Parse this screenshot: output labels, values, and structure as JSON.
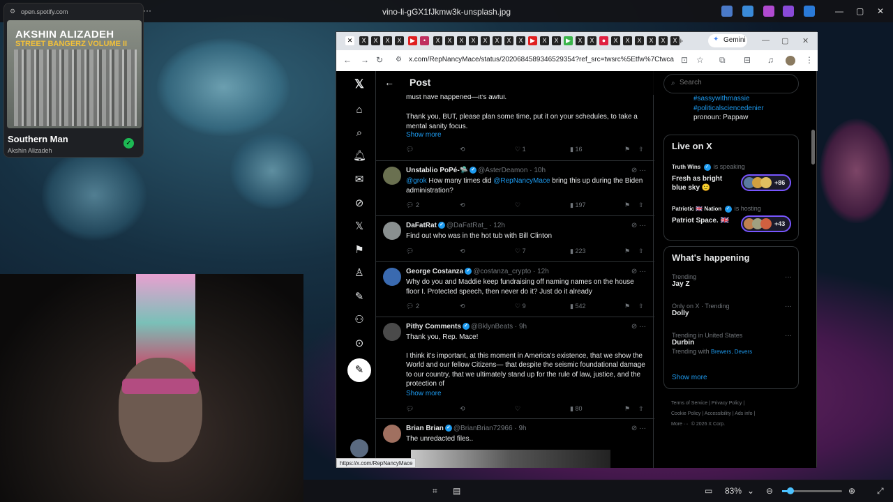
{
  "os": {
    "window_title": "vino-li-gGX1fJkmw3k-unsplash.jpg",
    "zoom": "83%"
  },
  "spotify": {
    "url": "open.spotify.com",
    "album_line1": "AKSHIN ALIZADEH",
    "album_line2": "STREET BANGERZ VOLUME II",
    "song": "Southern Man",
    "artist": "Akshin Alizadeh"
  },
  "browser": {
    "gemini_label": "Gemini",
    "url": "x.com/RepNancyMace/status/2020684589346529354?ref_src=twsrc%5Etfw%7Ctwcamp%5...",
    "status_url": "https://x.com/RepNancyMace"
  },
  "feed": {
    "header_title": "Post",
    "top_fragment_1": "must have happened—it's awful.",
    "top_fragment_2": "Thank you, BUT, please plan some time, put it on your schedules, to take a mental sanity focus.",
    "top_show_more": "Show more",
    "top_actions": {
      "likes": "1",
      "views": "16"
    },
    "tweets": [
      {
        "name": "Unstablio PoPé-🛸",
        "handle": "@AsterDeamon · 10h",
        "mention1": "@grok",
        "text_mid": " How many times did ",
        "mention2": "@RepNancyMace",
        "text_end": " bring this up during the Biden administration?",
        "replies": "2",
        "likes": "",
        "views": "197"
      },
      {
        "name": "DaFatRat",
        "handle": "@DaFatRat_ · 12h",
        "text": "Find out who was in the hot tub with Bill Clinton",
        "replies": "",
        "likes": "7",
        "views": "223"
      },
      {
        "name": "George Costanza",
        "handle": "@costanza_crypto · 12h",
        "text": "Why do you and Maddie keep fundraising off naming names on the house floor I. Protected speech, then never do it?  Just do it already",
        "replies": "2",
        "likes": "9",
        "views": "542"
      },
      {
        "name": "Pithy Comments",
        "handle": "@BklynBeats · 9h",
        "text1": "Thank you, Rep. Mace!",
        "text2": "I think it's important, at this moment in America's existence, that we show the World and our fellow Citizens— that despite the seismic foundational damage to our country, that we ultimately stand up for the rule of law, justice, and the protection of",
        "show_more": "Show more",
        "replies": "",
        "likes": "",
        "views": "80"
      },
      {
        "name": "Brian Brian",
        "handle": "@BrianBrian72966 · 9h",
        "text": "The unredacted files.."
      }
    ]
  },
  "rail": {
    "search_placeholder": "Search",
    "bio_tag1": "#sassywithmassie",
    "bio_tag2": "#politicalsciencedenier",
    "bio_pronoun": "pronoun: Pappaw",
    "live_title": "Live on X",
    "live": [
      {
        "host": "Truth Wins",
        "status": "is speaking",
        "title": "Fresh as bright blue sky 🙂",
        "count": "+86"
      },
      {
        "host": "Patriotic 🇬🇧 Nation",
        "status": "is hosting",
        "title": "Patriot Space. 🇬🇧",
        "count": "+43"
      }
    ],
    "happening_title": "What's happening",
    "trends": [
      {
        "context": "Trending",
        "name": "Jay Z"
      },
      {
        "context": "Only on X · Trending",
        "name": "Dolly"
      },
      {
        "context": "Trending in United States",
        "name": "Durbin",
        "with_label": "Trending with",
        "with_links": "Brewers, Devers"
      }
    ],
    "show_more": "Show more",
    "footer": [
      "Terms of Service",
      "Privacy Policy",
      "Cookie Policy",
      "Accessibility",
      "Ads info",
      "More ···",
      "© 2026 X Corp."
    ]
  },
  "colors": {
    "accent": "#1d9bf0",
    "verified": "#1d9bf0",
    "spotify_green": "#1db954"
  }
}
